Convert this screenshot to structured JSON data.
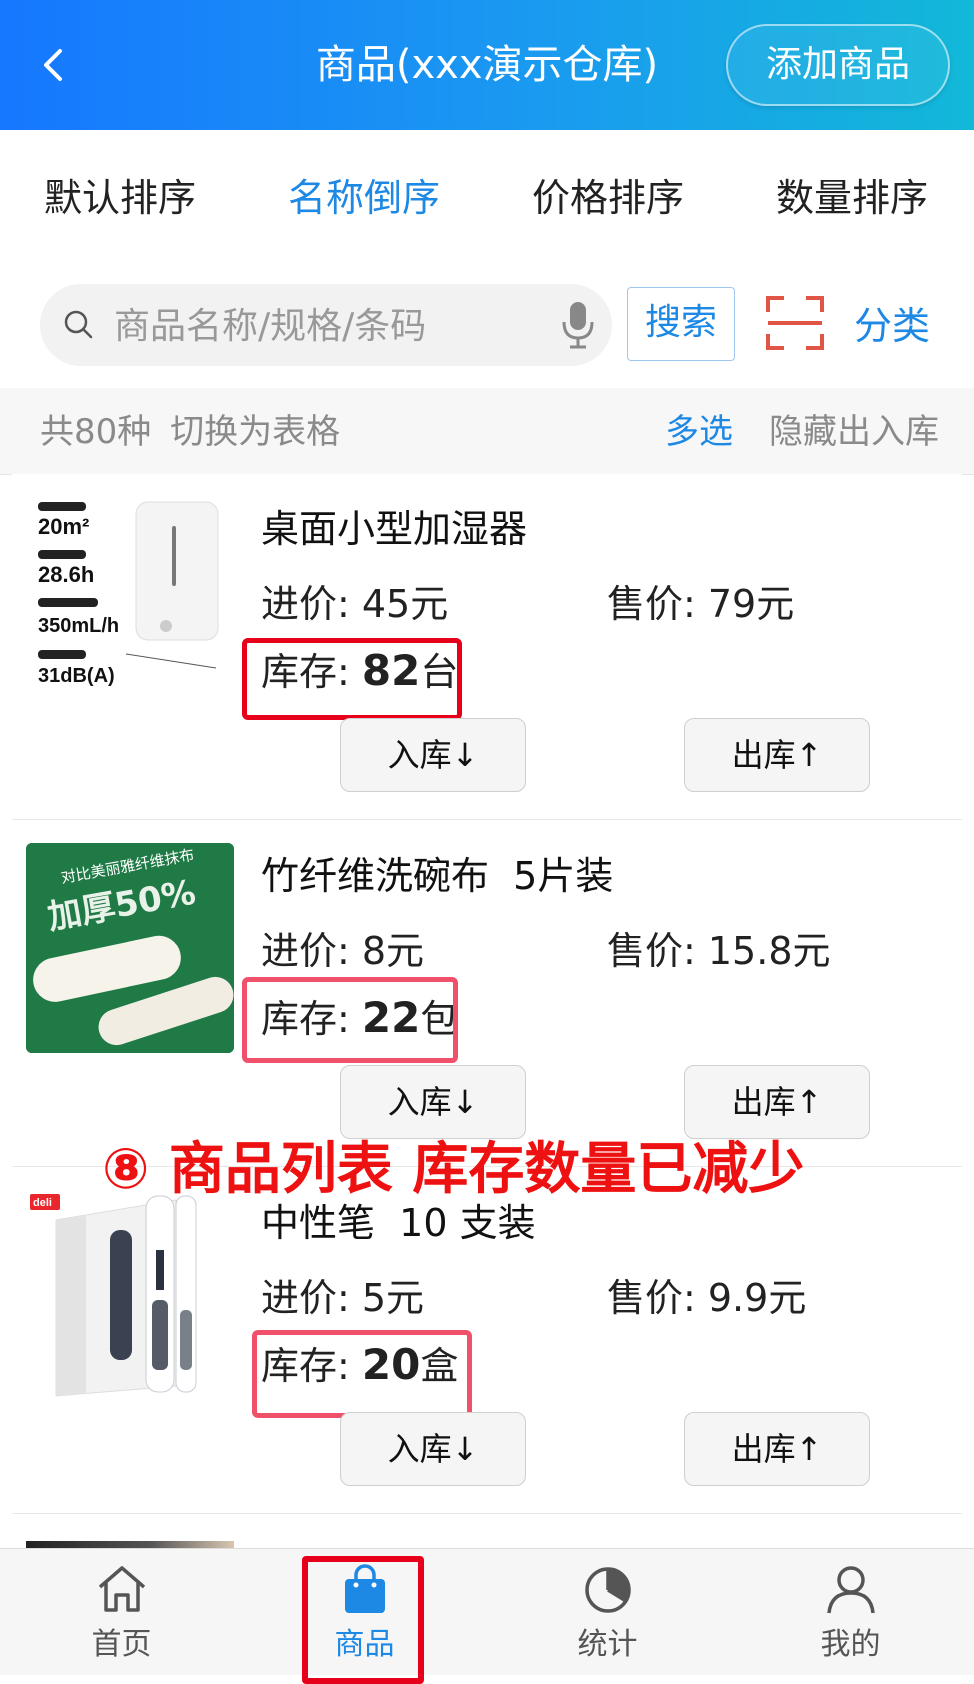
{
  "header": {
    "title": "商品(xxx演示仓库)",
    "add_button": "添加商品"
  },
  "sort_tabs": [
    {
      "label": "默认排序",
      "active": false
    },
    {
      "label": "名称倒序",
      "active": true
    },
    {
      "label": "价格排序",
      "active": false
    },
    {
      "label": "数量排序",
      "active": false
    }
  ],
  "search": {
    "placeholder": "商品名称/规格/条码",
    "button": "搜索",
    "category": "分类"
  },
  "info": {
    "count": "共80种",
    "switch": "切换为表格",
    "multi": "多选",
    "hide": "隐藏出入库"
  },
  "products": [
    {
      "name": "桌面小型加湿器",
      "price_in": "进价: 45元",
      "price_out": "售价: 79元",
      "stock_label": "库存: ",
      "stock_num": "82",
      "stock_unit": "台",
      "btn_in": "入库↓",
      "btn_out": "出库↑",
      "thumb_text": [
        "20m²",
        "28.6h",
        "350mL/h",
        "31dB(A)"
      ]
    },
    {
      "name": "竹纤维洗碗布  5片装",
      "price_in": "进价: 8元",
      "price_out": "售价: 15.8元",
      "stock_label": "库存: ",
      "stock_num": "22",
      "stock_unit": "包",
      "btn_in": "入库↓",
      "btn_out": "出库↑",
      "thumb_text": [
        "对比美丽雅纤维抹布",
        "加厚50%"
      ]
    },
    {
      "name": "中性笔  10 支装",
      "price_in": "进价: 5元",
      "price_out": "售价: 9.9元",
      "stock_label": "库存: ",
      "stock_num": "20",
      "stock_unit": "盒",
      "btn_in": "入库↓",
      "btn_out": "出库↑",
      "thumb_text": [
        "deli"
      ]
    }
  ],
  "annotation": "⑧ 商品列表 库存数量已减少",
  "tabbar": [
    {
      "label": "首页",
      "icon": "home-icon",
      "active": false
    },
    {
      "label": "商品",
      "icon": "bag-icon",
      "active": true
    },
    {
      "label": "统计",
      "icon": "stats-icon",
      "active": false
    },
    {
      "label": "我的",
      "icon": "user-icon",
      "active": false
    }
  ],
  "colors": {
    "accent": "#1e88e5",
    "highlight": "#e8001a"
  }
}
